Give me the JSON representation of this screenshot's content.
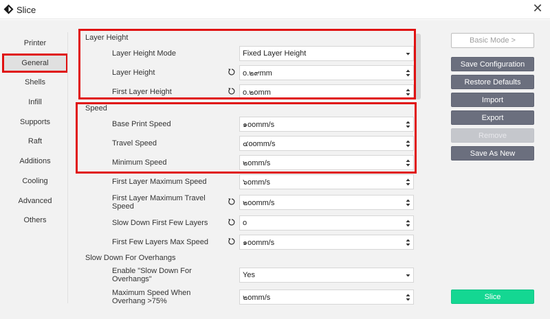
{
  "window": {
    "title": "Slice"
  },
  "nav": [
    {
      "label": "Printer"
    },
    {
      "label": "General"
    },
    {
      "label": "Shells"
    },
    {
      "label": "Infill"
    },
    {
      "label": "Supports"
    },
    {
      "label": "Raft"
    },
    {
      "label": "Additions"
    },
    {
      "label": "Cooling"
    },
    {
      "label": "Advanced"
    },
    {
      "label": "Others"
    }
  ],
  "active_nav": "General",
  "sections": {
    "layer_height": "Layer Height",
    "speed": "Speed",
    "slow_down": "Slow Down For Overhangs"
  },
  "fields": {
    "layer_height_mode": {
      "label": "Layer Height Mode",
      "value": "Fixed Layer Height"
    },
    "layer_height": {
      "label": "Layer Height",
      "value": "o.๒๙mm"
    },
    "first_layer_height": {
      "label": "First Layer Height",
      "value": "o.๒omm"
    },
    "base_print_speed": {
      "label": "Base Print Speed",
      "value": "๑oomm/s"
    },
    "travel_speed": {
      "label": "Travel Speed",
      "value": "๔oomm/s"
    },
    "minimum_speed": {
      "label": "Minimum Speed",
      "value": "๒omm/s"
    },
    "first_layer_max_speed": {
      "label": "First Layer Maximum Speed",
      "value": "๖omm/s"
    },
    "first_layer_max_travel_speed": {
      "label": "First Layer Maximum Travel Speed",
      "value": "๒oomm/s"
    },
    "slow_down_first_layers": {
      "label": "Slow Down First Few Layers",
      "value": "o"
    },
    "first_layers_max_speed": {
      "label": "First Few Layers Max Speed",
      "value": "๑oomm/s"
    },
    "enable_slow_down": {
      "label": "Enable \"Slow Down For Overhangs\"",
      "value": "Yes"
    },
    "max_speed_overhang": {
      "label": "Maximum Speed When Overhang >75%",
      "value": "๒omm/s"
    }
  },
  "buttons": {
    "basic_mode": "Basic Mode >",
    "save_configuration": "Save Configuration",
    "restore_defaults": "Restore Defaults",
    "import": "Import",
    "export": "Export",
    "remove": "Remove",
    "save_as_new": "Save As New",
    "slice": "Slice"
  },
  "colors": {
    "highlight": "#e01010",
    "dark_button": "#6b6f7e",
    "slice_button": "#14d792"
  }
}
